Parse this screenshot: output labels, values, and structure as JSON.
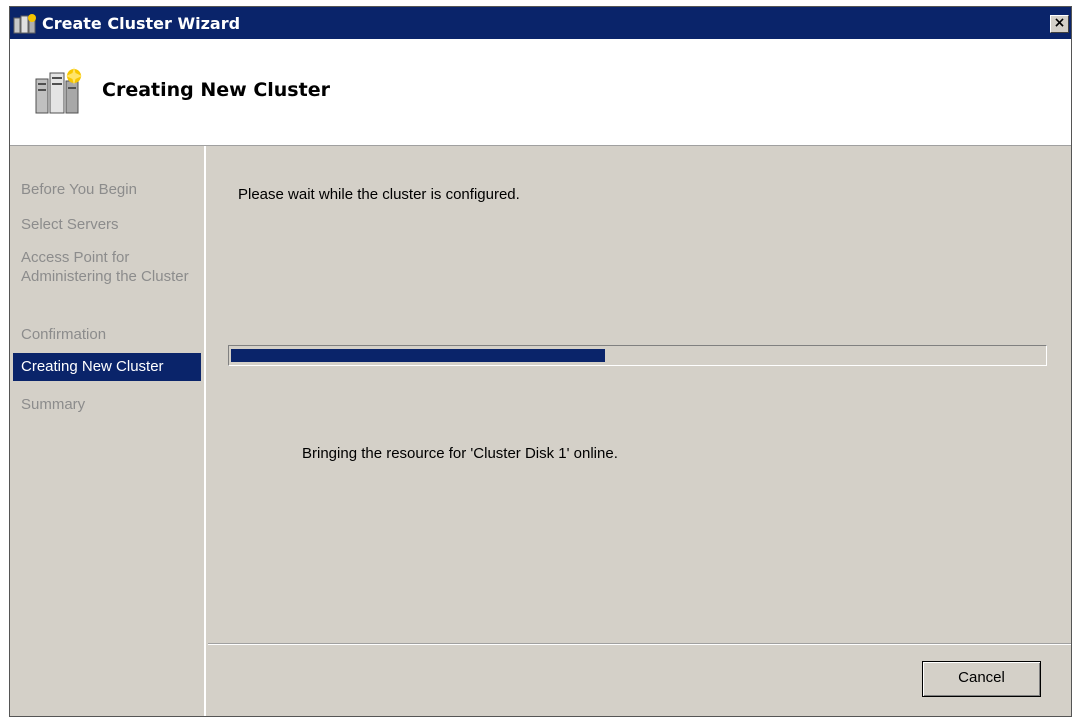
{
  "window": {
    "title": "Create Cluster Wizard",
    "close_glyph": "×",
    "icon": "cluster-wizard-icon"
  },
  "header": {
    "title": "Creating New Cluster",
    "icon": "cluster-servers-icon"
  },
  "sidebar": {
    "steps": [
      {
        "label": "Before You Begin",
        "state": "inactive"
      },
      {
        "label": "Select Servers",
        "state": "inactive"
      },
      {
        "label": "Access Point for Administering the Cluster",
        "state": "inactive"
      },
      {
        "label": "Confirmation",
        "state": "inactive"
      },
      {
        "label": "Creating New Cluster",
        "state": "active"
      },
      {
        "label": "Summary",
        "state": "inactive"
      }
    ]
  },
  "main": {
    "wait_text": "Please wait while the cluster is configured.",
    "progress": 0.46,
    "status_text": "Bringing the resource for 'Cluster Disk 1' online."
  },
  "footer": {
    "cancel_label": "Cancel"
  },
  "colors": {
    "titlebar": "#0a246a",
    "progress_fill": "#0a246a",
    "active_step": "#0a246a",
    "inactive_step_text": "#8c8c8c",
    "dialog_face": "#d4d0c8"
  }
}
